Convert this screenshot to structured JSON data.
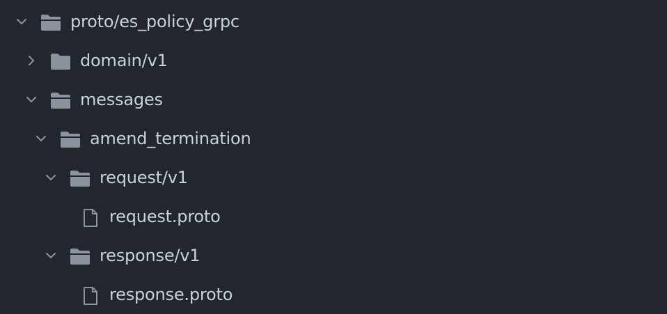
{
  "tree": {
    "rows": [
      {
        "label": "proto/es_policy_grpc",
        "type": "folder",
        "state": "expanded"
      },
      {
        "label": "domain/v1",
        "type": "folder",
        "state": "collapsed"
      },
      {
        "label": "messages",
        "type": "folder",
        "state": "expanded"
      },
      {
        "label": "amend_termination",
        "type": "folder",
        "state": "expanded"
      },
      {
        "label": "request/v1",
        "type": "folder",
        "state": "expanded"
      },
      {
        "label": "request.proto",
        "type": "file"
      },
      {
        "label": "response/v1",
        "type": "folder",
        "state": "expanded"
      },
      {
        "label": "response.proto",
        "type": "file"
      }
    ]
  },
  "colors": {
    "background": "#22272e",
    "text": "#c9d1d9",
    "icon": "#8b949e",
    "chevron": "#8b949e"
  },
  "icons": {
    "folder": "folder-icon",
    "file": "file-icon",
    "expanded": "chevron-down-icon",
    "collapsed": "chevron-right-icon"
  }
}
